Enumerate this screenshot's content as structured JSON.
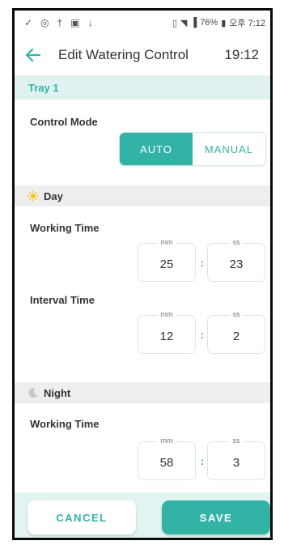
{
  "statusbar": {
    "battery": "76%",
    "clock": "오후 7:12"
  },
  "header": {
    "title": "Edit Watering Control",
    "time": "19:12"
  },
  "tray": {
    "label": "Tray 1"
  },
  "control_mode": {
    "label": "Control Mode",
    "options": [
      "AUTO",
      "MANUAL"
    ],
    "selected": "AUTO"
  },
  "day": {
    "label": "Day",
    "working_time": {
      "label": "Working Time",
      "mm": "25",
      "ss": "23"
    },
    "interval_time": {
      "label": "Interval Time",
      "mm": "12",
      "ss": "2"
    }
  },
  "night": {
    "label": "Night",
    "working_time": {
      "label": "Working Time",
      "mm": "58",
      "ss": "3"
    }
  },
  "units": {
    "minutes": "mm",
    "seconds": "ss",
    "separator": ":"
  },
  "footer": {
    "cancel_label": "CANCEL",
    "save_label": "SAVE"
  },
  "colors": {
    "accent": "#33b3a6",
    "tray_bg": "#dff2f0",
    "section_bg": "#eeeeee",
    "footer_bg": "#e2f4f2"
  },
  "icons": [
    "check-icon",
    "alarm-icon",
    "usb-icon",
    "image-icon",
    "download-icon",
    "vibrate-icon",
    "wifi-icon",
    "signal-icon",
    "battery-icon",
    "back-arrow-icon",
    "sun-icon",
    "moon-icon"
  ]
}
